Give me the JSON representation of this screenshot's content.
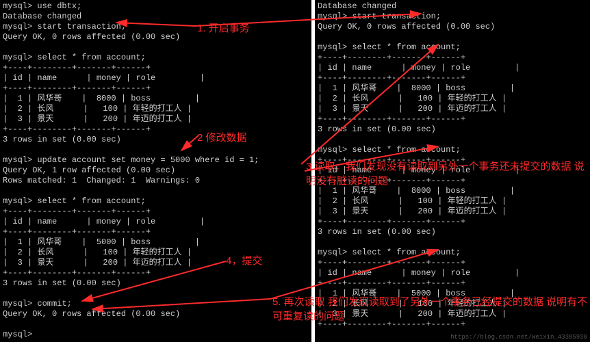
{
  "left": {
    "l0": "mysql> use dbtx;",
    "l1": "Database changed",
    "l2": "mysql> start transaction;",
    "l3": "Query OK, 0 rows affected (0.00 sec)",
    "l4": "",
    "l5": "mysql> select * from account;",
    "l6": "+----+--------+-------+------+",
    "l7": "| id | name      | money | role         |",
    "l8": "+----+--------+-------+------+",
    "l9": "|  1 | 风华哥    |  8000 | boss         |",
    "l10": "|  2 | 长风      |   100 | 年轻的打工人 |",
    "l11": "|  3 | 景天      |   200 | 年迈的打工人 |",
    "l12": "+----+--------+-------+------+",
    "l13": "3 rows in set (0.00 sec)",
    "l14": "",
    "l15": "mysql> update account set money = 5000 where id = 1;",
    "l16": "Query OK, 1 row affected (0.00 sec)",
    "l17": "Rows matched: 1  Changed: 1  Warnings: 0",
    "l18": "",
    "l19": "mysql> select * from account;",
    "l20": "+----+--------+-------+------+",
    "l21": "| id | name      | money | role         |",
    "l22": "+----+--------+-------+------+",
    "l23": "|  1 | 风华哥    |  5000 | boss         |",
    "l24": "|  2 | 长风      |   100 | 年轻的打工人 |",
    "l25": "|  3 | 景天      |   200 | 年迈的打工人 |",
    "l26": "+----+--------+-------+------+",
    "l27": "3 rows in set (0.00 sec)",
    "l28": "",
    "l29": "mysql> commit;",
    "l30": "Query OK, 0 rows affected (0.00 sec)",
    "l31": "",
    "l32": "mysql>"
  },
  "right": {
    "r0": "Database changed",
    "r1": "mysql> start transaction;",
    "r2": "Query OK, 0 rows affected (0.00 sec)",
    "r3": "",
    "r4": "mysql> select * from account;",
    "r5": "+----+--------+-------+------+",
    "r6": "| id | name      | money | role         |",
    "r7": "+----+--------+-------+------+",
    "r8": "|  1 | 风华哥    |  8000 | boss         |",
    "r9": "|  2 | 长风      |   100 | 年轻的打工人 |",
    "r10": "|  3 | 景天      |   200 | 年迈的打工人 |",
    "r11": "+----+--------+-------+------+",
    "r12": "3 rows in set (0.00 sec)",
    "r13": "",
    "r14": "mysql> select * from account;",
    "r15": "+----+--------+-------+------+",
    "r16": "| id | name      | money | role         |",
    "r17": "+----+--------+-------+------+",
    "r18": "|  1 | 风华哥    |  8000 | boss         |",
    "r19": "|  2 | 长风      |   100 | 年轻的打工人 |",
    "r20": "|  3 | 景天      |   200 | 年迈的打工人 |",
    "r21": "+----+--------+-------+------+",
    "r22": "3 rows in set (0.00 sec)",
    "r23": "",
    "r24": "mysql> select * from account;",
    "r25": "+----+--------+-------+------+",
    "r26": "| id | name      | money | role         |",
    "r27": "+----+--------+-------+------+",
    "r28": "|  1 | 风华哥    |  5000 | boss         |",
    "r29": "|  2 | 长风      |   100 | 年轻的打工人 |",
    "r30": "|  3 | 景天      |   200 | 年迈的打工人 |",
    "r31": "+----+--------+-------+------+"
  },
  "annot": {
    "a1": "1. 开启事务",
    "a2": "2 修改数据",
    "a3": "3 读取，我们发现没有读取到另外一个事务还未提交的数据 说明没有脏读的问题",
    "a4": "4，提交",
    "a5": "5. 再次读取 我们发现读取到了另外一个事务已经提交的数据 说明有不可重复读的问题"
  },
  "watermark": "https://blog.csdn.net/weixin_43385930"
}
